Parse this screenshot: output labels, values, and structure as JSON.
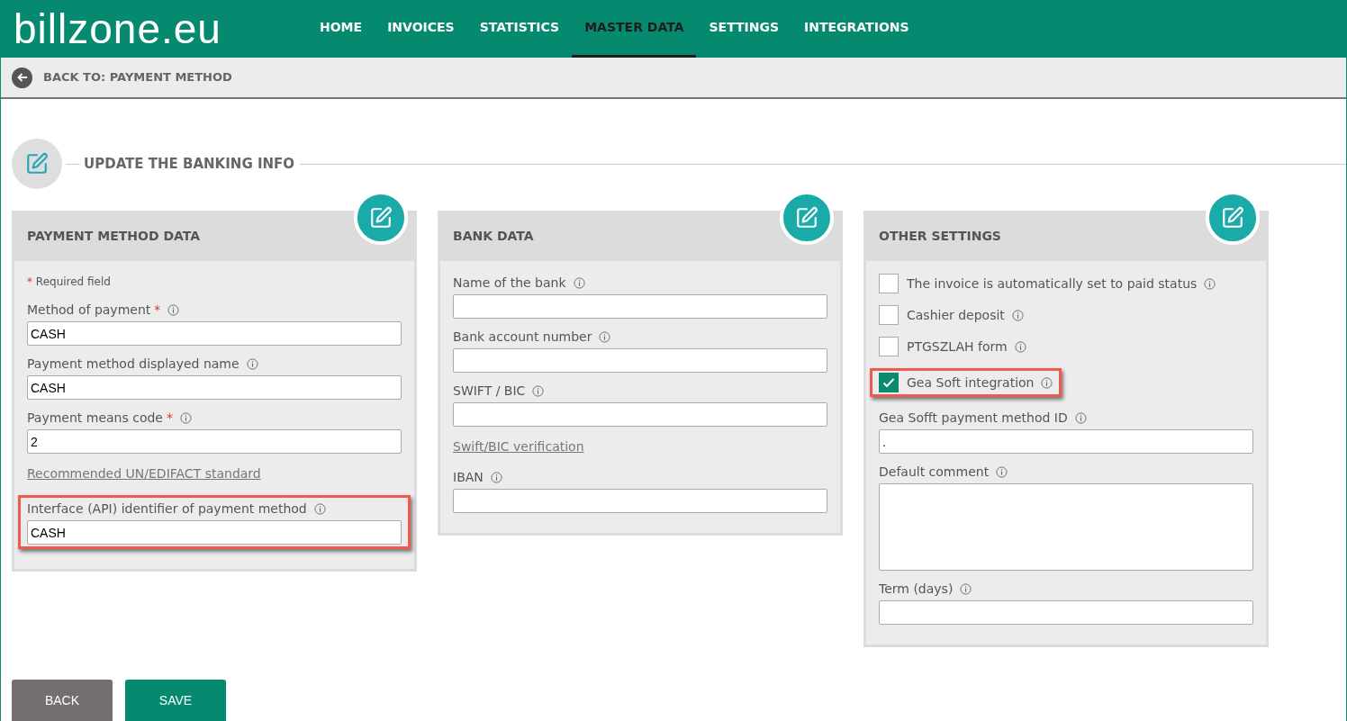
{
  "logo": "billzone.eu",
  "nav": [
    {
      "label": "HOME",
      "selected": false
    },
    {
      "label": "INVOICES",
      "selected": false
    },
    {
      "label": "STATISTICS",
      "selected": false
    },
    {
      "label": "MASTER DATA",
      "selected": true
    },
    {
      "label": "SETTINGS",
      "selected": false
    },
    {
      "label": "INTEGRATIONS",
      "selected": false
    }
  ],
  "breadcrumb": "BACK TO: PAYMENT METHOD",
  "section_title": "UPDATE THE BANKING INFO",
  "panels": [
    {
      "title": "PAYMENT METHOD DATA",
      "items": [
        {
          "kind": "note",
          "mark": "*",
          "label": "Required field"
        },
        {
          "kind": "field",
          "label": "Method of payment",
          "required": true,
          "value": "CASH",
          "highlighted": false
        },
        {
          "kind": "field",
          "label": "Payment method displayed name",
          "required": false,
          "value": "CASH",
          "highlighted": false
        },
        {
          "kind": "field",
          "label": "Payment means code",
          "required": true,
          "value": "2",
          "highlighted": false
        },
        {
          "kind": "link",
          "label": "Recommended UN/EDIFACT standard"
        },
        {
          "kind": "field",
          "label": "Interface (API) identifier of payment method",
          "required": false,
          "value": "CASH",
          "highlighted": true
        }
      ]
    },
    {
      "title": "BANK DATA",
      "items": [
        {
          "kind": "field",
          "label": "Name of the bank",
          "required": false,
          "highlighted": false
        },
        {
          "kind": "field",
          "label": "Bank account number",
          "required": false,
          "highlighted": false
        },
        {
          "kind": "field",
          "label": "SWIFT / BIC",
          "required": false,
          "highlighted": false
        },
        {
          "kind": "link",
          "label": "Swift/BIC verification"
        },
        {
          "kind": "field",
          "label": "IBAN",
          "required": false,
          "highlighted": false
        }
      ]
    },
    {
      "title": "OTHER SETTINGS",
      "items": [
        {
          "kind": "checkbox",
          "label": "The invoice is automatically set to paid status",
          "checked": false,
          "highlighted": false
        },
        {
          "kind": "checkbox",
          "label": "Cashier deposit",
          "checked": false,
          "highlighted": false
        },
        {
          "kind": "checkbox",
          "label": "PTGSZLAH form",
          "checked": false,
          "highlighted": false
        },
        {
          "kind": "checkbox",
          "label": "Gea Soft integration",
          "checked": true,
          "highlighted": true
        },
        {
          "kind": "field",
          "label": "Gea Sofft payment method ID",
          "required": false,
          "value": ".",
          "highlighted": false
        },
        {
          "kind": "textarea",
          "label": "Default comment",
          "required": false,
          "highlighted": false
        },
        {
          "kind": "field",
          "label": "Term (days)",
          "required": false,
          "highlighted": false
        }
      ]
    }
  ],
  "buttons": [
    {
      "label": "BACK",
      "kind": "secondary"
    },
    {
      "label": "SAVE",
      "kind": "primary"
    }
  ]
}
